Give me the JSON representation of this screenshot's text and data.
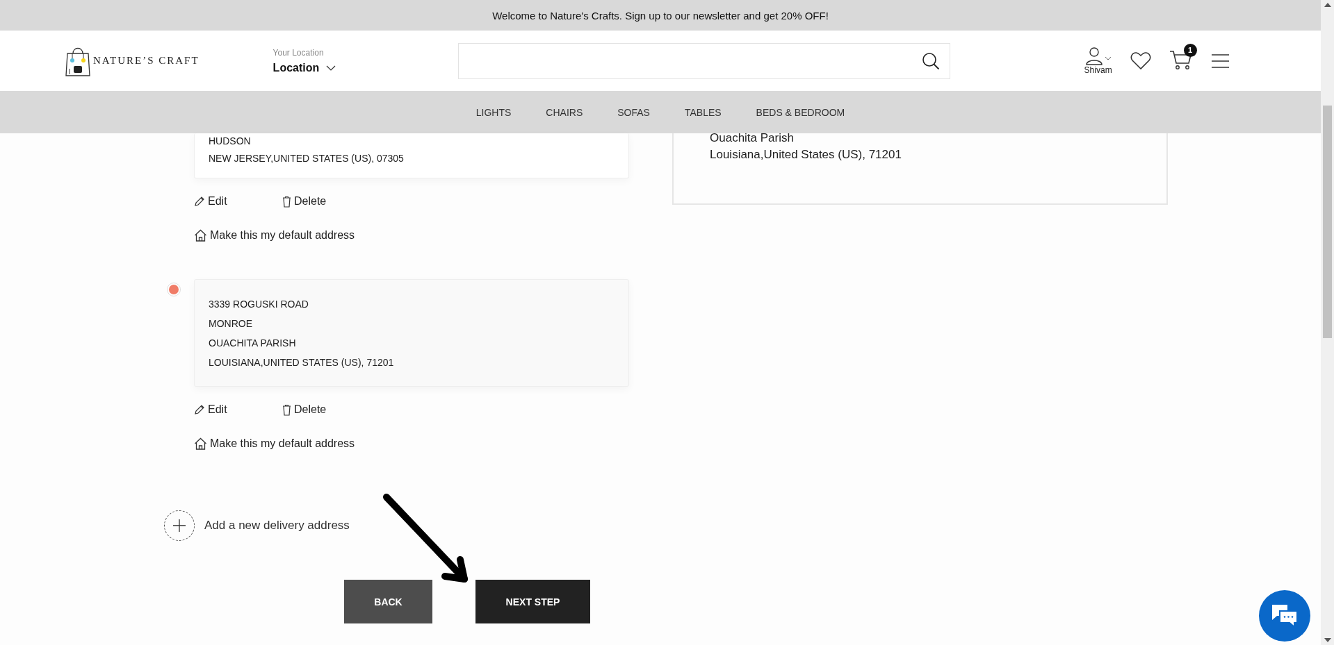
{
  "announcement": "Welcome to Nature's Crafts. Sign up to our newsletter and get 20% OFF!",
  "header": {
    "logo_text": "NATURE’S CRAFT",
    "location_label": "Your Location",
    "location_value": "Location",
    "user_name": "Shivam",
    "cart_count": "1"
  },
  "nav": [
    "LIGHTS",
    "CHAIRS",
    "SOFAS",
    "TABLES",
    "BEDS & BEDROOM"
  ],
  "addresses": [
    {
      "lines": [
        "HUDSON",
        "NEW JERSEY,UNITED STATES (US), 07305"
      ],
      "edit_label": "Edit",
      "delete_label": "Delete",
      "default_label": "Make this my default address"
    },
    {
      "selected": true,
      "lines": [
        "3339 ROGUSKI ROAD",
        "MONROE",
        "OUACHITA PARISH",
        "LOUISIANA,UNITED STATES (US), 71201"
      ],
      "edit_label": "Edit",
      "delete_label": "Delete",
      "default_label": "Make this my default address"
    }
  ],
  "summary": {
    "lines": [
      "Ouachita Parish",
      "Louisiana,United States (US), 71201"
    ]
  },
  "add_address": "Add a new delivery address",
  "buttons": [
    {
      "label": "BACK",
      "kind": "secondary"
    },
    {
      "label": "NEXT STEP",
      "kind": "primary"
    }
  ]
}
